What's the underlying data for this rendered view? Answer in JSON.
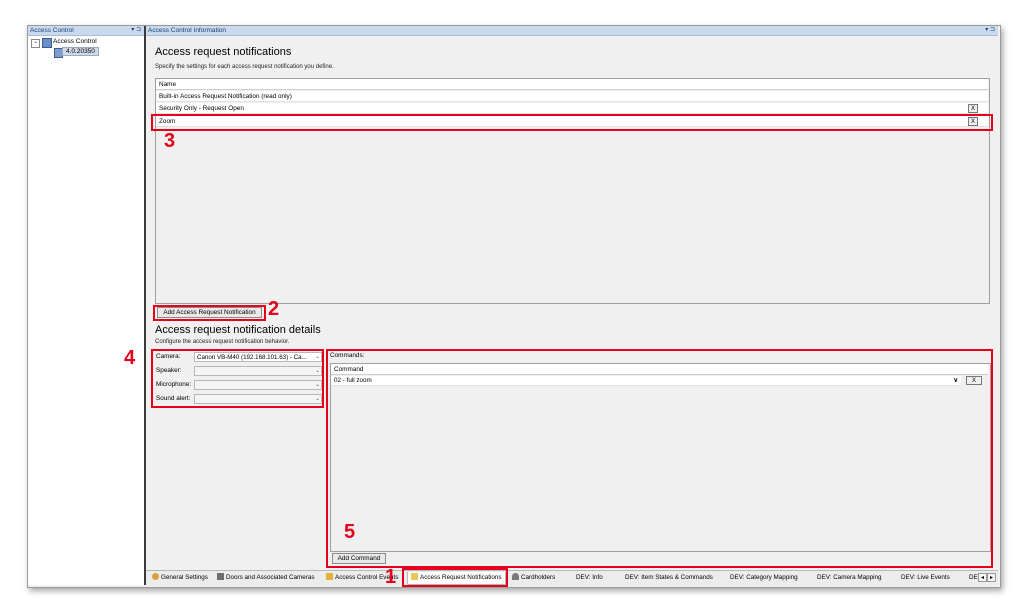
{
  "left_panel": {
    "header": "Access Control",
    "header_controls": "▾ ⊐",
    "tree": {
      "root": "Access Control",
      "child": "4.0.20350"
    }
  },
  "main": {
    "header": "Access Control Information",
    "header_controls": "▾ ⊐",
    "notifications": {
      "title": "Access request notifications",
      "subtitle": "Specify the settings for each access request notification you define.",
      "column": "Name",
      "rows": [
        "Built-in Access Request Notification (read only)",
        "Security Only - Request Open",
        "Zoom"
      ],
      "remove_label": "X",
      "add_button": "Add Access Request Notification"
    },
    "details": {
      "title": "Access request notification details",
      "subtitle": "Configure the access request notification behavior.",
      "fields": [
        {
          "label": "Camera:",
          "value": "Canon VB-M40 (192.168.101.63) - Ca..."
        },
        {
          "label": "Speaker:",
          "value": ""
        },
        {
          "label": "Microphone:",
          "value": ""
        },
        {
          "label": "Sound alert:",
          "value": ""
        }
      ],
      "commands_label": "Commands:",
      "command_column": "Command",
      "command_value": "02 - full zoom",
      "add_command": "Add Command"
    }
  },
  "tabs": [
    "General Settings",
    "Doors and Associated Cameras",
    "Access Control Events",
    "Access Request Notifications",
    "Cardholders",
    "DEV: Info",
    "DEV: Item States & Commands",
    "DEV: Category Mapping",
    "DEV: Camera Mapping",
    "DEV: Live Events",
    "DE"
  ],
  "annotations": [
    "1",
    "2",
    "3",
    "4",
    "5"
  ],
  "colors": {
    "annotation": "#e6001a",
    "header": "#c9d9ee"
  }
}
